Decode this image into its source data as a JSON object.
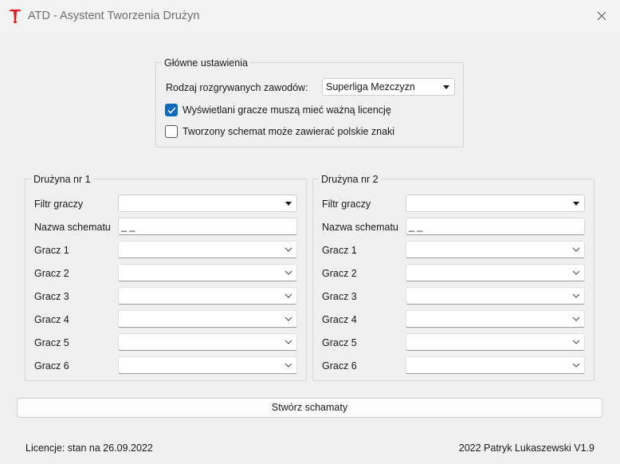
{
  "window": {
    "title": "ATD - Asystent Tworzenia Drużyn",
    "logo_icon": "red-t-logo-icon",
    "close_icon": "close-icon"
  },
  "settings": {
    "legend": "Główne ustawienia",
    "competition_label": "Rodzaj rozgrywanych zawodów:",
    "competition_value": "Superliga Mezczyzn",
    "license_checkbox_label": "Wyświetlani gracze muszą mieć ważną licencję",
    "license_checked": true,
    "polish_checkbox_label": "Tworzony schemat może zawierać polskie znaki",
    "polish_checked": false
  },
  "teams": [
    {
      "legend": "Drużyna nr 1",
      "filter_label": "Filtr graczy",
      "filter_value": "",
      "schema_label": "Nazwa schematu",
      "schema_value": "_ _",
      "players": [
        {
          "label": "Gracz 1",
          "value": ""
        },
        {
          "label": "Gracz 2",
          "value": ""
        },
        {
          "label": "Gracz 3",
          "value": ""
        },
        {
          "label": "Gracz 4",
          "value": ""
        },
        {
          "label": "Gracz 5",
          "value": ""
        },
        {
          "label": "Gracz 6",
          "value": ""
        }
      ]
    },
    {
      "legend": "Drużyna nr 2",
      "filter_label": "Filtr graczy",
      "filter_value": "",
      "schema_label": "Nazwa schematu",
      "schema_value": "_ _",
      "players": [
        {
          "label": "Gracz 1",
          "value": ""
        },
        {
          "label": "Gracz 2",
          "value": ""
        },
        {
          "label": "Gracz 3",
          "value": ""
        },
        {
          "label": "Gracz 4",
          "value": ""
        },
        {
          "label": "Gracz 5",
          "value": ""
        },
        {
          "label": "Gracz 6",
          "value": ""
        }
      ]
    }
  ],
  "actions": {
    "create_button_label": "Stwórz schamaty"
  },
  "footer": {
    "license_info": "Licencje: stan na 26.09.2022",
    "author_version": "2022 Patryk Lukaszewski V1.9"
  },
  "colors": {
    "logo_red": "#e0202a",
    "checkbox_accent": "#0f6cbd"
  }
}
